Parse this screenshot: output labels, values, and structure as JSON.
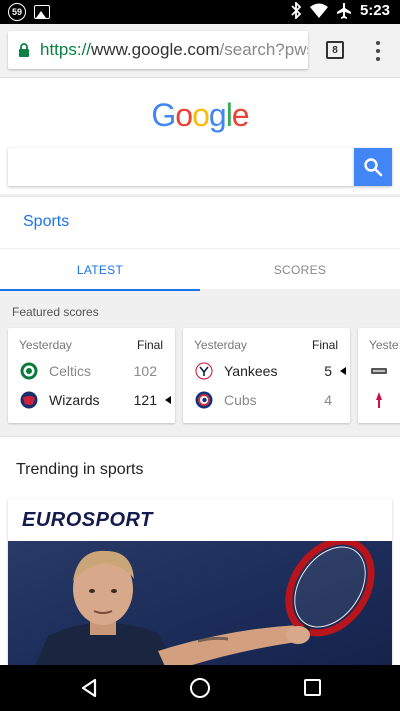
{
  "status_bar": {
    "notification_count": "59",
    "time": "5:23"
  },
  "browser": {
    "url_scheme": "https://",
    "url_host": "www.google.com",
    "url_path": "/search?pws",
    "tab_count": "8"
  },
  "google": {
    "logo_letters": [
      "G",
      "o",
      "o",
      "g",
      "l",
      "e"
    ],
    "logo_colors": [
      "#4285F4",
      "#EA4335",
      "#FBBC05",
      "#4285F4",
      "#34A853",
      "#EA4335"
    ],
    "search_value": "",
    "search_button_color": "#4285F4"
  },
  "sports": {
    "title": "Sports",
    "tabs": [
      {
        "label": "LATEST",
        "active": true
      },
      {
        "label": "SCORES",
        "active": false
      }
    ],
    "featured_label": "Featured scores",
    "games": [
      {
        "date": "Yesterday",
        "status": "Final",
        "teams": [
          {
            "name": "Celtics",
            "score": "102",
            "logo_icon": "celtics-logo-icon",
            "winner": false
          },
          {
            "name": "Wizards",
            "score": "121",
            "logo_icon": "wizards-logo-icon",
            "winner": true
          }
        ]
      },
      {
        "date": "Yesterday",
        "status": "Final",
        "teams": [
          {
            "name": "Yankees",
            "score": "5",
            "logo_icon": "yankees-logo-icon",
            "winner": true
          },
          {
            "name": "Cubs",
            "score": "4",
            "logo_icon": "cubs-logo-icon",
            "winner": false
          }
        ]
      },
      {
        "date": "Yeste",
        "status": "",
        "teams": [
          {
            "name": "",
            "score": "",
            "logo_icon": "spurs-logo-icon",
            "winner": false
          },
          {
            "name": "",
            "score": "",
            "logo_icon": "rockets-logo-icon",
            "winner": false
          }
        ]
      }
    ]
  },
  "trending": {
    "title": "Trending in sports",
    "source": "EUROSPORT",
    "image_icon": "tennis-player-photo"
  }
}
